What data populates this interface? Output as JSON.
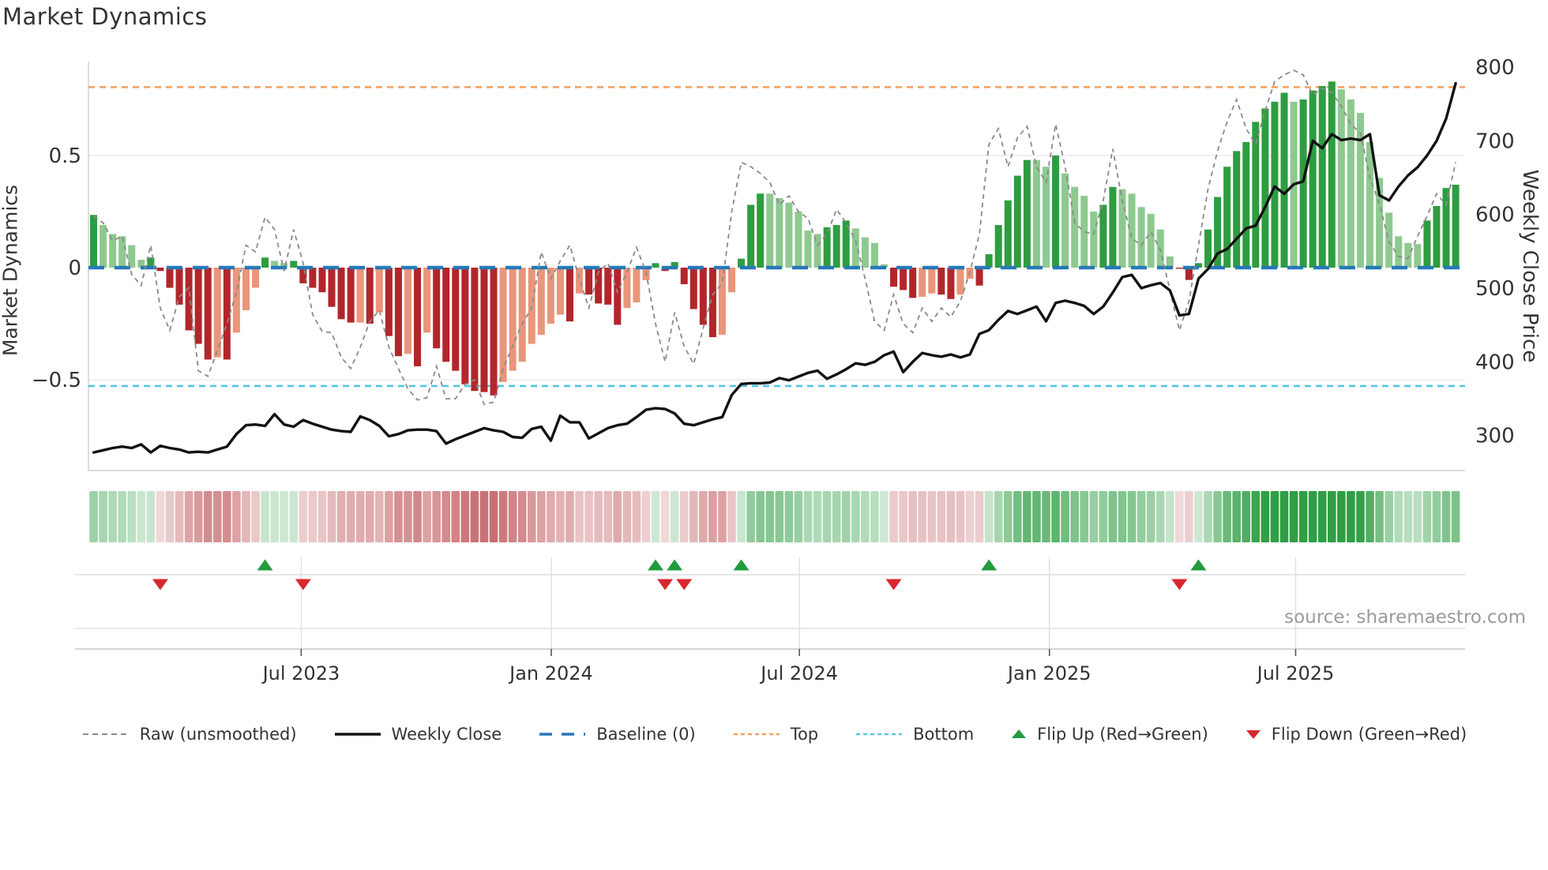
{
  "title": "Market Dynamics",
  "source_text": "source: sharemaestro.com",
  "colors": {
    "bar_dark_green": "#2e9d40",
    "bar_light_green": "#8ec98f",
    "bar_dark_red": "#b2262b",
    "bar_light_red": "#e9967a",
    "baseline_blue": "#2679b8",
    "top_orange": "#f3a15f",
    "bottom_cyan": "#53c6e4",
    "raw_gray": "#8a8a8a",
    "price_black": "#121212",
    "flip_up_green": "#229b3d",
    "flip_down_red": "#d7282f",
    "heat_green_base": "#2f9e44",
    "heat_red_base": "#be555a",
    "grid": "#e7e7e7",
    "spine": "#cfcfcf",
    "text_dark": "#333333",
    "text_muted": "#9b9b9b"
  },
  "legend": {
    "items": [
      {
        "key": "raw",
        "label": "Raw (unsmoothed)"
      },
      {
        "key": "close",
        "label": "Weekly Close"
      },
      {
        "key": "baseline",
        "label": "Baseline (0)"
      },
      {
        "key": "top",
        "label": "Top"
      },
      {
        "key": "bottom",
        "label": "Bottom"
      },
      {
        "key": "flipup",
        "label": "Flip Up (Red→Green)"
      },
      {
        "key": "flipdown",
        "label": "Flip Down (Green→Red)"
      }
    ]
  },
  "chart_data": {
    "type": "bar+line combo with heatmap strip and flip markers",
    "n_weeks": 144,
    "left_axis": {
      "label": "Market Dynamics",
      "tick_values": [
        0.5,
        0,
        -0.5
      ],
      "tick_labels": [
        "0.5",
        "0",
        "−0.5"
      ],
      "range": [
        -0.905,
        0.919
      ]
    },
    "right_axis": {
      "label": "Weekly Close Price",
      "tick_values": [
        800,
        700,
        600,
        500,
        400,
        300
      ],
      "tick_labels": [
        "800",
        "700",
        "600",
        "500",
        "400",
        "300"
      ],
      "range": [
        252,
        808
      ]
    },
    "x_axis": {
      "tick_labels": [
        "Jul 2023",
        "Jan 2024",
        "Jul 2024",
        "Jan 2025",
        "Jul 2025"
      ],
      "tick_weeks": [
        21.8,
        48.05,
        74.1,
        100.35,
        126.2
      ]
    },
    "top_line_value": 0.805,
    "bottom_line_value": -0.528,
    "baseline_value": 0,
    "flip_up_weeks": [
      18,
      59,
      61,
      68,
      94,
      116
    ],
    "flip_down_weeks": [
      7,
      22,
      60,
      62,
      84,
      114
    ],
    "series": {
      "oscillator": [
        0.235,
        0.19,
        0.15,
        0.14,
        0.1,
        0.035,
        0.045,
        -0.015,
        -0.09,
        -0.165,
        -0.28,
        -0.34,
        -0.41,
        -0.4,
        -0.41,
        -0.29,
        -0.19,
        -0.09,
        0.045,
        0.03,
        0.02,
        0.03,
        -0.07,
        -0.09,
        -0.11,
        -0.175,
        -0.23,
        -0.245,
        -0.245,
        -0.25,
        -0.2,
        -0.305,
        -0.395,
        -0.385,
        -0.44,
        -0.29,
        -0.36,
        -0.42,
        -0.46,
        -0.52,
        -0.55,
        -0.555,
        -0.57,
        -0.51,
        -0.46,
        -0.42,
        -0.34,
        -0.3,
        -0.25,
        -0.21,
        -0.24,
        -0.115,
        -0.12,
        -0.16,
        -0.165,
        -0.255,
        -0.18,
        -0.155,
        -0.056,
        0.02,
        -0.015,
        0.025,
        -0.074,
        -0.185,
        -0.255,
        -0.31,
        -0.3,
        -0.11,
        0.04,
        0.28,
        0.33,
        0.33,
        0.31,
        0.29,
        0.25,
        0.165,
        0.15,
        0.18,
        0.19,
        0.21,
        0.175,
        0.135,
        0.11,
        0.015,
        -0.085,
        -0.1,
        -0.135,
        -0.13,
        -0.115,
        -0.12,
        -0.14,
        -0.12,
        -0.05,
        -0.08,
        0.06,
        0.19,
        0.3,
        0.41,
        0.48,
        0.48,
        0.45,
        0.5,
        0.42,
        0.36,
        0.32,
        0.25,
        0.28,
        0.36,
        0.35,
        0.33,
        0.27,
        0.24,
        0.17,
        0.05,
        -0.005,
        -0.055,
        0.02,
        0.17,
        0.315,
        0.45,
        0.52,
        0.56,
        0.65,
        0.71,
        0.74,
        0.78,
        0.74,
        0.75,
        0.79,
        0.81,
        0.83,
        0.795,
        0.75,
        0.69,
        0.56,
        0.4,
        0.245,
        0.14,
        0.11,
        0.105,
        0.21,
        0.275,
        0.355,
        0.37
      ],
      "raw": [
        0.23,
        0.2,
        0.12,
        0.14,
        -0.03,
        -0.08,
        0.1,
        -0.18,
        -0.28,
        -0.13,
        -0.09,
        -0.46,
        -0.485,
        -0.37,
        -0.25,
        -0.11,
        0.1,
        0.07,
        0.225,
        0.17,
        -0.015,
        0.17,
        0.02,
        -0.21,
        -0.285,
        -0.29,
        -0.4,
        -0.45,
        -0.355,
        -0.24,
        -0.19,
        -0.355,
        -0.45,
        -0.54,
        -0.59,
        -0.58,
        -0.44,
        -0.585,
        -0.585,
        -0.52,
        -0.5,
        -0.61,
        -0.6,
        -0.45,
        -0.35,
        -0.25,
        -0.18,
        0.07,
        -0.05,
        0.03,
        0.1,
        -0.05,
        -0.18,
        -0.02,
        0.02,
        -0.11,
        -0.02,
        0.09,
        -0.02,
        -0.25,
        -0.42,
        -0.2,
        -0.35,
        -0.43,
        -0.27,
        -0.12,
        -0.07,
        0.25,
        0.47,
        0.45,
        0.42,
        0.38,
        0.28,
        0.32,
        0.25,
        0.22,
        0.1,
        0.15,
        0.26,
        0.2,
        0.12,
        -0.05,
        -0.24,
        -0.28,
        -0.12,
        -0.25,
        -0.29,
        -0.18,
        -0.24,
        -0.18,
        -0.22,
        -0.15,
        -0.02,
        0.15,
        0.55,
        0.62,
        0.45,
        0.58,
        0.63,
        0.45,
        0.38,
        0.64,
        0.45,
        0.2,
        0.16,
        0.15,
        0.3,
        0.53,
        0.3,
        0.13,
        0.1,
        0.16,
        0.08,
        -0.1,
        -0.28,
        -0.15,
        0.1,
        0.35,
        0.52,
        0.65,
        0.75,
        0.62,
        0.55,
        0.7,
        0.83,
        0.86,
        0.88,
        0.86,
        0.77,
        0.8,
        0.78,
        0.72,
        0.64,
        0.6,
        0.4,
        0.285,
        0.115,
        0.05,
        0.04,
        0.14,
        0.23,
        0.33,
        0.28,
        0.47
      ],
      "weekly_close": [
        277,
        280,
        283,
        285,
        283,
        288,
        277,
        286,
        283,
        281,
        277,
        278,
        277,
        281,
        285,
        302,
        314,
        315,
        313,
        329,
        315,
        312,
        321,
        316,
        312,
        308,
        306,
        305,
        326,
        321,
        313,
        299,
        302,
        307,
        308,
        308,
        306,
        289,
        295,
        300,
        305,
        310,
        307,
        305,
        298,
        297,
        309,
        312,
        293,
        327,
        318,
        318,
        296,
        303,
        310,
        314,
        316,
        325,
        335,
        337,
        336,
        330,
        316,
        314,
        318,
        322,
        325,
        355,
        370,
        371,
        371,
        372,
        378,
        375,
        380,
        385,
        388,
        377,
        383,
        390,
        398,
        396,
        400,
        409,
        414,
        386,
        400,
        412,
        409,
        407,
        410,
        406,
        410,
        438,
        443,
        457,
        469,
        465,
        470,
        475,
        455,
        480,
        483,
        480,
        476,
        465,
        475,
        494,
        515,
        518,
        500,
        504,
        507,
        497,
        463,
        465,
        513,
        526,
        547,
        553,
        567,
        581,
        585,
        610,
        638,
        628,
        641,
        645,
        700,
        690,
        709,
        701,
        703,
        701,
        709,
        626,
        619,
        638,
        653,
        664,
        680,
        700,
        730,
        778
      ]
    }
  }
}
